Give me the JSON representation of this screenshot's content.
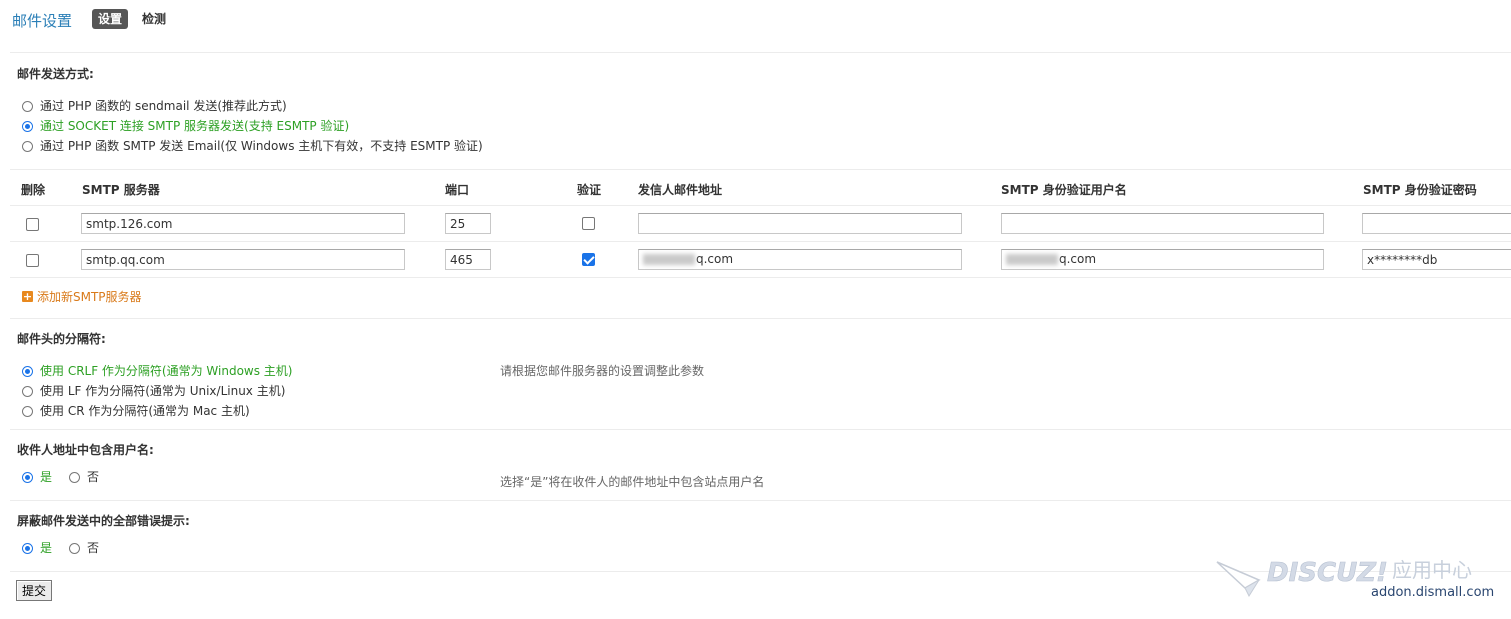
{
  "header": {
    "title": "邮件设置",
    "tabs": [
      {
        "label": "设置",
        "active": true
      },
      {
        "label": "检测",
        "active": false
      }
    ]
  },
  "send_method": {
    "title": "邮件发送方式:",
    "options": [
      {
        "label": "通过 PHP 函数的 sendmail 发送(推荐此方式)",
        "checked": false
      },
      {
        "label": "通过 SOCKET 连接 SMTP 服务器发送(支持 ESMTP 验证)",
        "checked": true
      },
      {
        "label": "通过 PHP 函数 SMTP 发送 Email(仅 Windows 主机下有效，不支持 ESMTP 验证)",
        "checked": false
      }
    ]
  },
  "smtp_table": {
    "headers": {
      "delete": "删除",
      "server": "SMTP 服务器",
      "port": "端口",
      "auth": "验证",
      "from": "发信人邮件地址",
      "username": "SMTP 身份验证用户名",
      "password": "SMTP 身份验证密码"
    },
    "rows": [
      {
        "delete": false,
        "server": "smtp.126.com",
        "port": "25",
        "auth": false,
        "from": "",
        "username": "",
        "password": ""
      },
      {
        "delete": false,
        "server": "smtp.qq.com",
        "port": "465",
        "auth": true,
        "from": "q.com",
        "username": "q.com",
        "password": "x********db"
      }
    ],
    "add_label": "添加新SMTP服务器"
  },
  "separator": {
    "title": "邮件头的分隔符:",
    "options": [
      {
        "label": "使用 CRLF 作为分隔符(通常为 Windows 主机)",
        "checked": true
      },
      {
        "label": "使用 LF 作为分隔符(通常为 Unix/Linux 主机)",
        "checked": false
      },
      {
        "label": "使用 CR 作为分隔符(通常为 Mac 主机)",
        "checked": false
      }
    ],
    "hint": "请根据您邮件服务器的设置调整此参数"
  },
  "include_username": {
    "title": "收件人地址中包含用户名:",
    "yes": "是",
    "no": "否",
    "value": "yes",
    "hint": "选择“是”将在收件人的邮件地址中包含站点用户名"
  },
  "silent": {
    "title": "屏蔽邮件发送中的全部错误提示:",
    "yes": "是",
    "no": "否",
    "value": "yes"
  },
  "submit_label": "提交",
  "watermark": {
    "brand": "DISCUZ!",
    "tagline": "应用中心",
    "domain": "addon.dismall.com"
  },
  "colors": {
    "accent": "#2b7fb7",
    "checked_text": "#2da024",
    "link": "#d97a1a"
  }
}
